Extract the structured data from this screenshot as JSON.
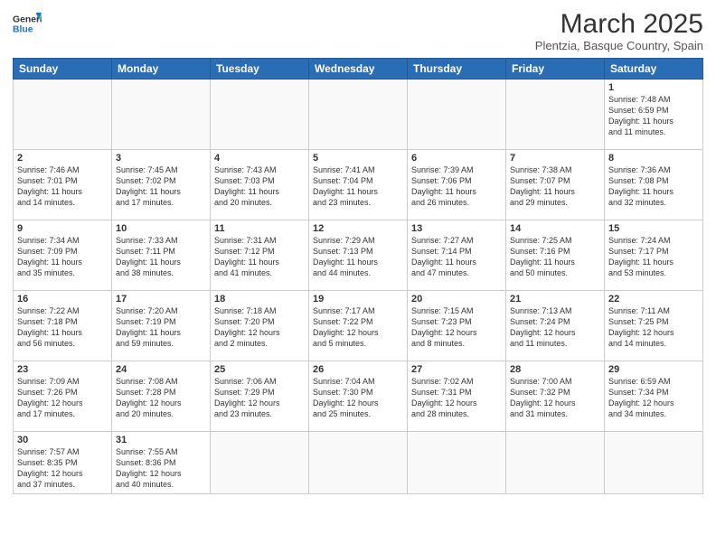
{
  "header": {
    "logo_general": "General",
    "logo_blue": "Blue",
    "title": "March 2025",
    "subtitle": "Plentzia, Basque Country, Spain"
  },
  "weekdays": [
    "Sunday",
    "Monday",
    "Tuesday",
    "Wednesday",
    "Thursday",
    "Friday",
    "Saturday"
  ],
  "weeks": [
    [
      {
        "day": "",
        "info": ""
      },
      {
        "day": "",
        "info": ""
      },
      {
        "day": "",
        "info": ""
      },
      {
        "day": "",
        "info": ""
      },
      {
        "day": "",
        "info": ""
      },
      {
        "day": "",
        "info": ""
      },
      {
        "day": "1",
        "info": "Sunrise: 7:48 AM\nSunset: 6:59 PM\nDaylight: 11 hours\nand 11 minutes."
      }
    ],
    [
      {
        "day": "2",
        "info": "Sunrise: 7:46 AM\nSunset: 7:01 PM\nDaylight: 11 hours\nand 14 minutes."
      },
      {
        "day": "3",
        "info": "Sunrise: 7:45 AM\nSunset: 7:02 PM\nDaylight: 11 hours\nand 17 minutes."
      },
      {
        "day": "4",
        "info": "Sunrise: 7:43 AM\nSunset: 7:03 PM\nDaylight: 11 hours\nand 20 minutes."
      },
      {
        "day": "5",
        "info": "Sunrise: 7:41 AM\nSunset: 7:04 PM\nDaylight: 11 hours\nand 23 minutes."
      },
      {
        "day": "6",
        "info": "Sunrise: 7:39 AM\nSunset: 7:06 PM\nDaylight: 11 hours\nand 26 minutes."
      },
      {
        "day": "7",
        "info": "Sunrise: 7:38 AM\nSunset: 7:07 PM\nDaylight: 11 hours\nand 29 minutes."
      },
      {
        "day": "8",
        "info": "Sunrise: 7:36 AM\nSunset: 7:08 PM\nDaylight: 11 hours\nand 32 minutes."
      }
    ],
    [
      {
        "day": "9",
        "info": "Sunrise: 7:34 AM\nSunset: 7:09 PM\nDaylight: 11 hours\nand 35 minutes."
      },
      {
        "day": "10",
        "info": "Sunrise: 7:33 AM\nSunset: 7:11 PM\nDaylight: 11 hours\nand 38 minutes."
      },
      {
        "day": "11",
        "info": "Sunrise: 7:31 AM\nSunset: 7:12 PM\nDaylight: 11 hours\nand 41 minutes."
      },
      {
        "day": "12",
        "info": "Sunrise: 7:29 AM\nSunset: 7:13 PM\nDaylight: 11 hours\nand 44 minutes."
      },
      {
        "day": "13",
        "info": "Sunrise: 7:27 AM\nSunset: 7:14 PM\nDaylight: 11 hours\nand 47 minutes."
      },
      {
        "day": "14",
        "info": "Sunrise: 7:25 AM\nSunset: 7:16 PM\nDaylight: 11 hours\nand 50 minutes."
      },
      {
        "day": "15",
        "info": "Sunrise: 7:24 AM\nSunset: 7:17 PM\nDaylight: 11 hours\nand 53 minutes."
      }
    ],
    [
      {
        "day": "16",
        "info": "Sunrise: 7:22 AM\nSunset: 7:18 PM\nDaylight: 11 hours\nand 56 minutes."
      },
      {
        "day": "17",
        "info": "Sunrise: 7:20 AM\nSunset: 7:19 PM\nDaylight: 11 hours\nand 59 minutes."
      },
      {
        "day": "18",
        "info": "Sunrise: 7:18 AM\nSunset: 7:20 PM\nDaylight: 12 hours\nand 2 minutes."
      },
      {
        "day": "19",
        "info": "Sunrise: 7:17 AM\nSunset: 7:22 PM\nDaylight: 12 hours\nand 5 minutes."
      },
      {
        "day": "20",
        "info": "Sunrise: 7:15 AM\nSunset: 7:23 PM\nDaylight: 12 hours\nand 8 minutes."
      },
      {
        "day": "21",
        "info": "Sunrise: 7:13 AM\nSunset: 7:24 PM\nDaylight: 12 hours\nand 11 minutes."
      },
      {
        "day": "22",
        "info": "Sunrise: 7:11 AM\nSunset: 7:25 PM\nDaylight: 12 hours\nand 14 minutes."
      }
    ],
    [
      {
        "day": "23",
        "info": "Sunrise: 7:09 AM\nSunset: 7:26 PM\nDaylight: 12 hours\nand 17 minutes."
      },
      {
        "day": "24",
        "info": "Sunrise: 7:08 AM\nSunset: 7:28 PM\nDaylight: 12 hours\nand 20 minutes."
      },
      {
        "day": "25",
        "info": "Sunrise: 7:06 AM\nSunset: 7:29 PM\nDaylight: 12 hours\nand 23 minutes."
      },
      {
        "day": "26",
        "info": "Sunrise: 7:04 AM\nSunset: 7:30 PM\nDaylight: 12 hours\nand 25 minutes."
      },
      {
        "day": "27",
        "info": "Sunrise: 7:02 AM\nSunset: 7:31 PM\nDaylight: 12 hours\nand 28 minutes."
      },
      {
        "day": "28",
        "info": "Sunrise: 7:00 AM\nSunset: 7:32 PM\nDaylight: 12 hours\nand 31 minutes."
      },
      {
        "day": "29",
        "info": "Sunrise: 6:59 AM\nSunset: 7:34 PM\nDaylight: 12 hours\nand 34 minutes."
      }
    ],
    [
      {
        "day": "30",
        "info": "Sunrise: 7:57 AM\nSunset: 8:35 PM\nDaylight: 12 hours\nand 37 minutes."
      },
      {
        "day": "31",
        "info": "Sunrise: 7:55 AM\nSunset: 8:36 PM\nDaylight: 12 hours\nand 40 minutes."
      },
      {
        "day": "",
        "info": ""
      },
      {
        "day": "",
        "info": ""
      },
      {
        "day": "",
        "info": ""
      },
      {
        "day": "",
        "info": ""
      },
      {
        "day": "",
        "info": ""
      }
    ]
  ]
}
